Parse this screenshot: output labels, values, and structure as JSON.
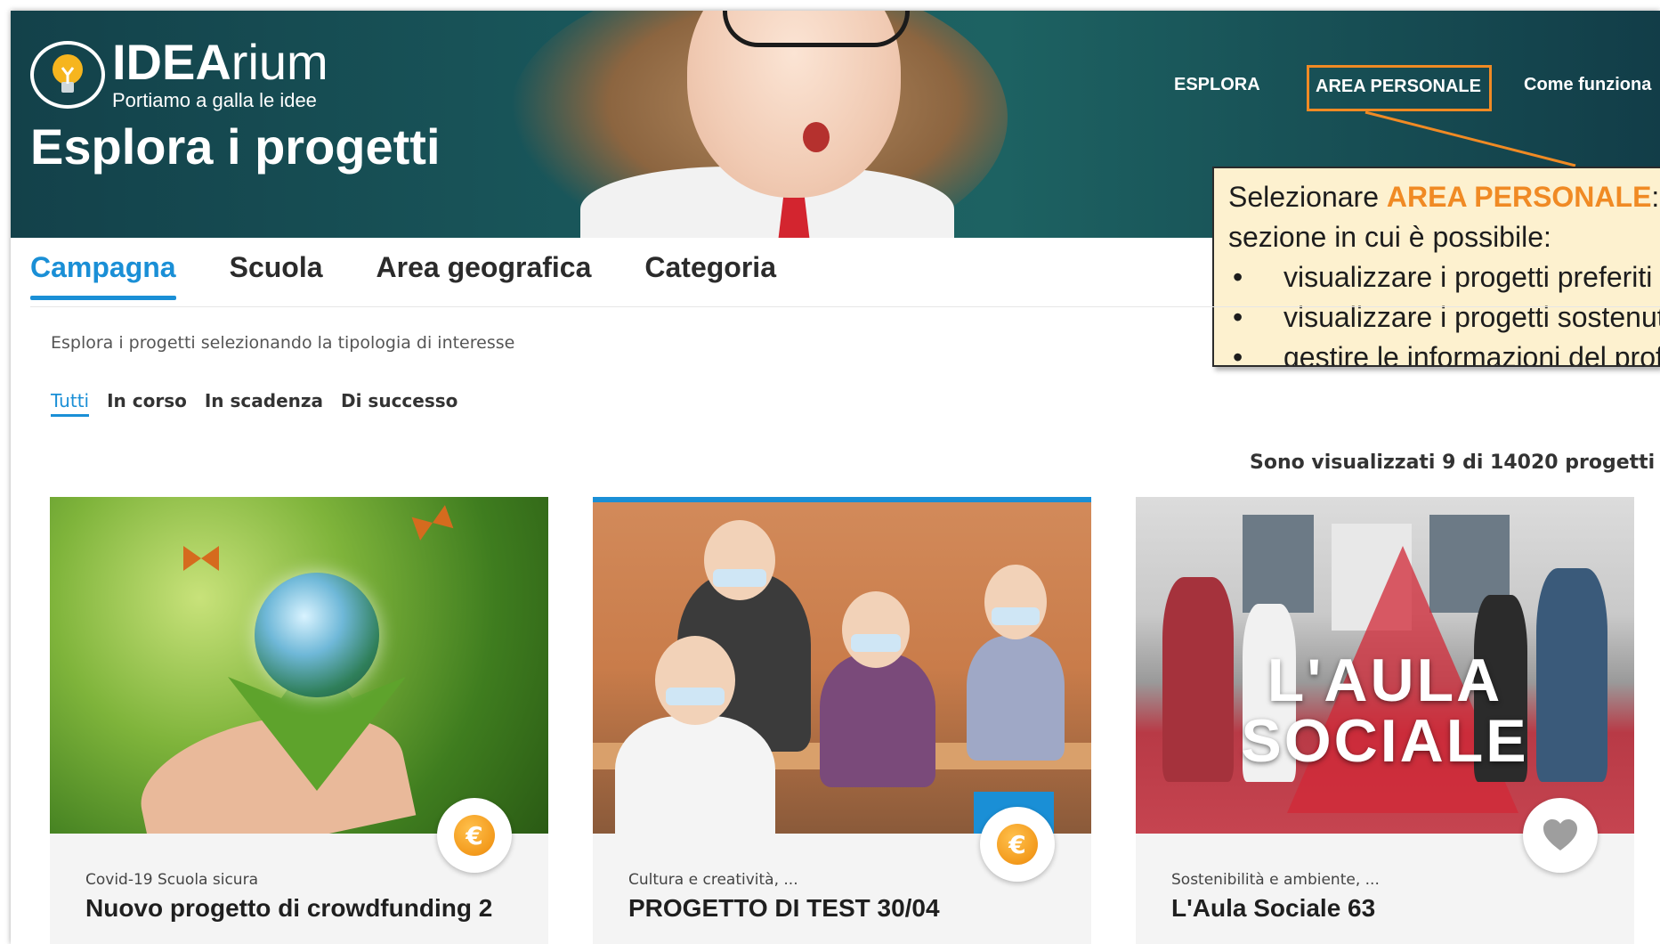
{
  "logo": {
    "name_bold": "IDEA",
    "name_rest": "rium",
    "tagline": "Portiamo a galla le idee"
  },
  "hero": {
    "title": "Esplora i progetti"
  },
  "nav": {
    "esplora": "ESPLORA",
    "area_personale": "AREA PERSONALE",
    "come_funziona": "Come funziona"
  },
  "callout": {
    "line1_prefix": "Selezionare ",
    "line1_accent": "AREA PERSONALE",
    "line1_suffix": ":",
    "line2": "sezione in cui è possibile:",
    "bullets": [
      "visualizzare i progetti preferiti",
      "visualizzare i progetti sostenuti",
      "gestire le informazioni del profilo"
    ],
    "accent_color": "#f08a24",
    "background": "#fdf1cf"
  },
  "tabs": [
    "Campagna",
    "Scuola",
    "Area geografica",
    "Categoria"
  ],
  "active_tab": "Campagna",
  "hint": "Esplora i progetti selezionando la tipologia di interesse",
  "filters": [
    "Tutti",
    "In corso",
    "In scadenza",
    "Di successo"
  ],
  "active_filter": "Tutti",
  "count_text": "Sono visualizzati 9 di 14020 progetti",
  "cards": [
    {
      "category": "Covid-19 Scuola sicura",
      "title": "Nuovo progetto di crowdfunding 2",
      "badge": "euro-coin-icon"
    },
    {
      "category": "Cultura e creatività, ...",
      "title": "PROGETTO DI TEST 30/04",
      "badge": "euro-coin-icon"
    },
    {
      "category": "Sostenibilità e ambiente, ...",
      "title": "L'Aula Sociale 63",
      "badge": "heart-icon",
      "image_text_1": "L'AULA",
      "image_text_2": "SOCIALE"
    }
  ],
  "coin_symbol": "€",
  "colors": {
    "accent_blue": "#1a8fd6",
    "orange": "#f08a24"
  }
}
